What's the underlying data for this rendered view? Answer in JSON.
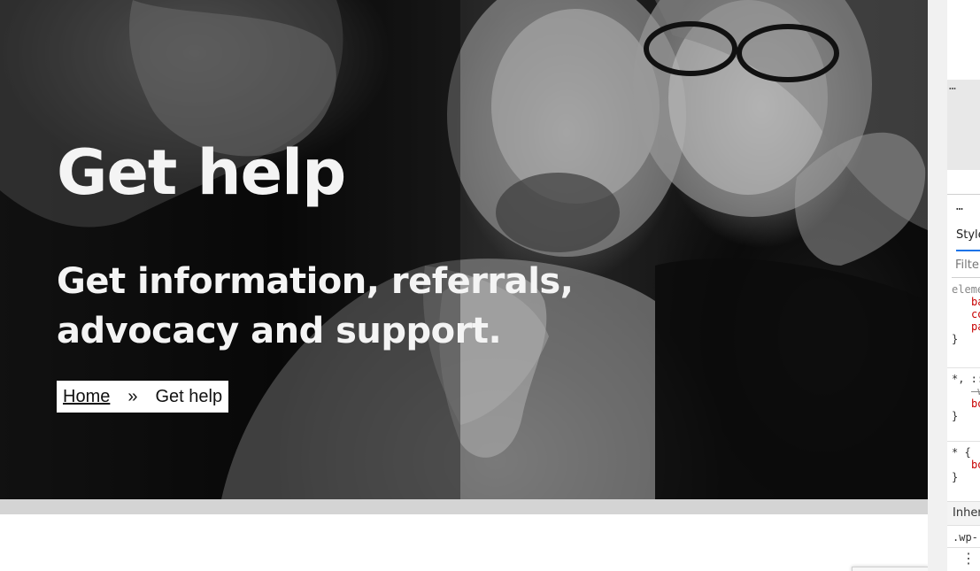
{
  "hero": {
    "title": "Get help",
    "subtitle": "Get information, referrals, advocacy and support."
  },
  "breadcrumb": {
    "home_label": "Home",
    "separator": "»",
    "current_label": "Get help"
  },
  "devtools": {
    "dom_ellipsis": "…",
    "crumbs_ellipsis": "…",
    "styles_tab_label": "Styles",
    "filter_placeholder": "Filter",
    "rules": [
      {
        "selector": "element.style {",
        "props": [
          "background",
          "color",
          "padding"
        ]
      },
      {
        "selector": "*, ::before, ::after {",
        "props": [
          "-webkit-box-sizing",
          "box-sizing"
        ]
      },
      {
        "selector": "* {",
        "props": [
          "box-sizing"
        ]
      }
    ],
    "close_brace": "}",
    "inherited_label": "Inherited from",
    "wp_selector": ".wp-",
    "kebab": "⋮"
  },
  "colors": {
    "hero_text": "#f4f4f4",
    "breadcrumb_bg": "#ffffff",
    "hero_strip": "#d4d4d4",
    "devtools_accent": "#1a73e8",
    "css_property": "#c80000"
  }
}
